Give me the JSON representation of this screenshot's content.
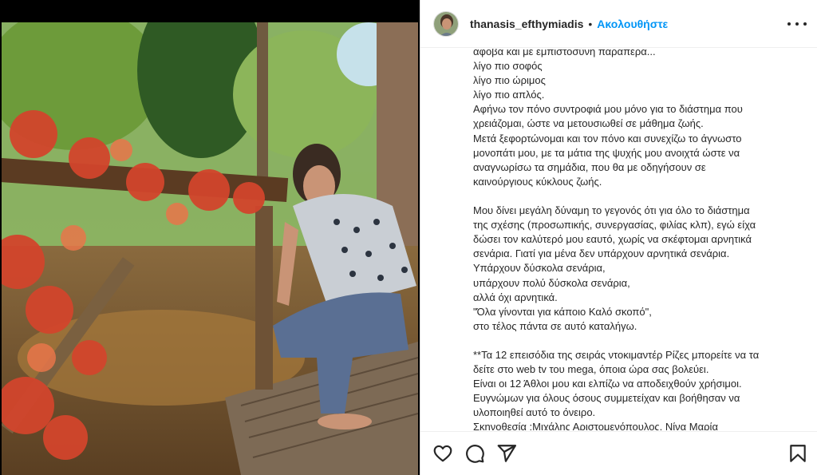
{
  "post": {
    "username": "thanasis_efthymiadis",
    "separator": "•",
    "follow_label": "Ακολουθήστε",
    "more_icon": "more-horizontal-icon"
  },
  "caption": {
    "lines": [
      "άφοβα και με εμπιστοσύνη παραπέρα...",
      "λίγο πιο σοφός",
      "λίγο πιο ώριμος",
      "λίγο πιο απλός.",
      "Αφήνω τον πόνο συντροφιά μου μόνο για το διάστημα που",
      "χρειάζομαι, ώστε να μετουσιωθεί σε μάθημα ζωής.",
      "Μετά ξεφορτώνομαι και τον πόνο και συνεχίζω το άγνωστο",
      "μονοπάτι μου, με τα μάτια της ψυχής μου ανοιχτά ώστε να",
      "αναγνωρίσω τα σημάδια, που θα με οδηγήσουν σε",
      "καινούργιους κύκλους ζωής.",
      "",
      "Μου δίνει μεγάλη δύναμη το γεγονός ότι για όλο το διάστημα",
      "της σχέσης (προσωπικής, συνεργασίας, φιλίας κλπ), εγώ είχα",
      "δώσει τον καλύτερό μου εαυτό, χωρίς να σκέφτομαι αρνητικά",
      "σενάρια. Γιατί για μένα δεν υπάρχουν αρνητικά σενάρια.",
      "Υπάρχουν δύσκολα σενάρια,",
      "υπάρχουν πολύ δύσκολα σενάρια,",
      "αλλά όχι αρνητικά.",
      "\"Όλα γίνονται για κάποιο Καλό σκοπό\",",
      "στο τέλος πάντα σε αυτό καταλήγω.",
      "",
      "**Τα 12 επεισόδια της σειράς ντοκιμαντέρ Ρίζες μπορείτε να τα",
      "δείτε στο web tv του mega, όποια ώρα σας βολεύει.",
      "Είναι οι 12 Άθλοι μου και ελπίζω να αποδειχθούν χρήσιμοι.",
      "Ευγνώμων για όλους όσους συμμετείχαν και βοήθησαν να",
      "υλοποιηθεί αυτό το όνειρο.",
      "Σκηνοθεσία :Μιχάλης Αριστομενόπουλος, Νίνα Μαρία"
    ]
  },
  "actions": {
    "like_icon": "heart-icon",
    "comment_icon": "comment-icon",
    "share_icon": "share-icon",
    "save_icon": "bookmark-icon"
  },
  "colors": {
    "follow_blue": "#0095f6",
    "text": "#262626",
    "border": "#dbdbdb"
  }
}
